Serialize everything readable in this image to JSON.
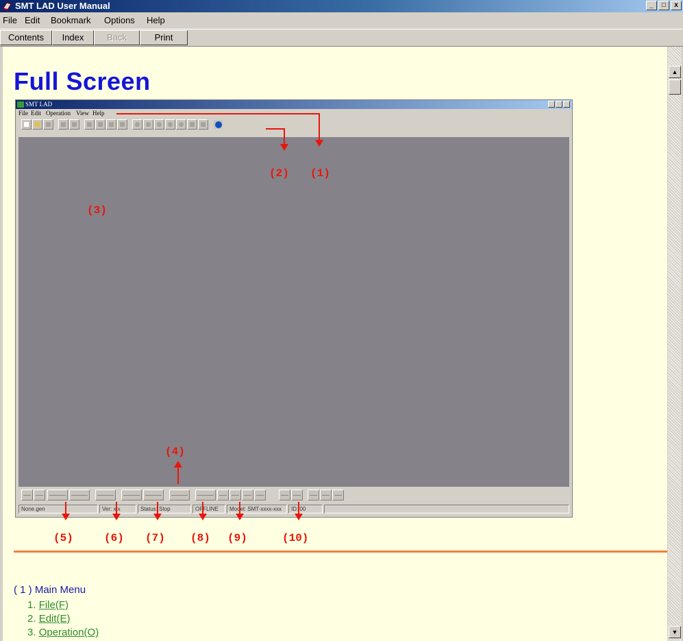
{
  "window": {
    "title": "SMT LAD User Manual",
    "controls": [
      "_",
      "□",
      "x"
    ]
  },
  "menu": [
    "File",
    "Edit",
    "Bookmark",
    "Options",
    "Help"
  ],
  "toolbar": {
    "contents": "Contents",
    "index": "Index",
    "back": "Back",
    "print": "Print"
  },
  "page": {
    "title": "Full Screen",
    "screenshot": {
      "title": "SMT LAD",
      "menu": [
        "File",
        "Edit",
        "Operation",
        "View",
        "Help"
      ],
      "status": {
        "file": "None.gen",
        "ver": "Ver: x.x",
        "status": "Status: Stop",
        "mode": "OFFLINE",
        "model": "Model: SMT-xxxx-xxx",
        "id": "ID: 00"
      }
    },
    "annotations": {
      "a1": "(1)",
      "a2": "(2)",
      "a3": "(3)",
      "a4": "(4)",
      "a5": "(5)",
      "a6": "(6)",
      "a7": "(7)",
      "a8": "(8)",
      "a9": "(9)",
      "a10": "(10)"
    },
    "section_heading": "( 1 ) Main Menu",
    "menu_items": [
      {
        "num": "1.",
        "label": "File(F)"
      },
      {
        "num": "2.",
        "label": "Edit(E)"
      },
      {
        "num": "3.",
        "label": "Operation(O)"
      }
    ]
  },
  "colors": {
    "titlebar": "#0a246a",
    "background": "#ffffe1",
    "title": "#1515d8",
    "annotation": "#e8160c",
    "rule": "#f07e3c",
    "link": "#2e8b2e"
  }
}
